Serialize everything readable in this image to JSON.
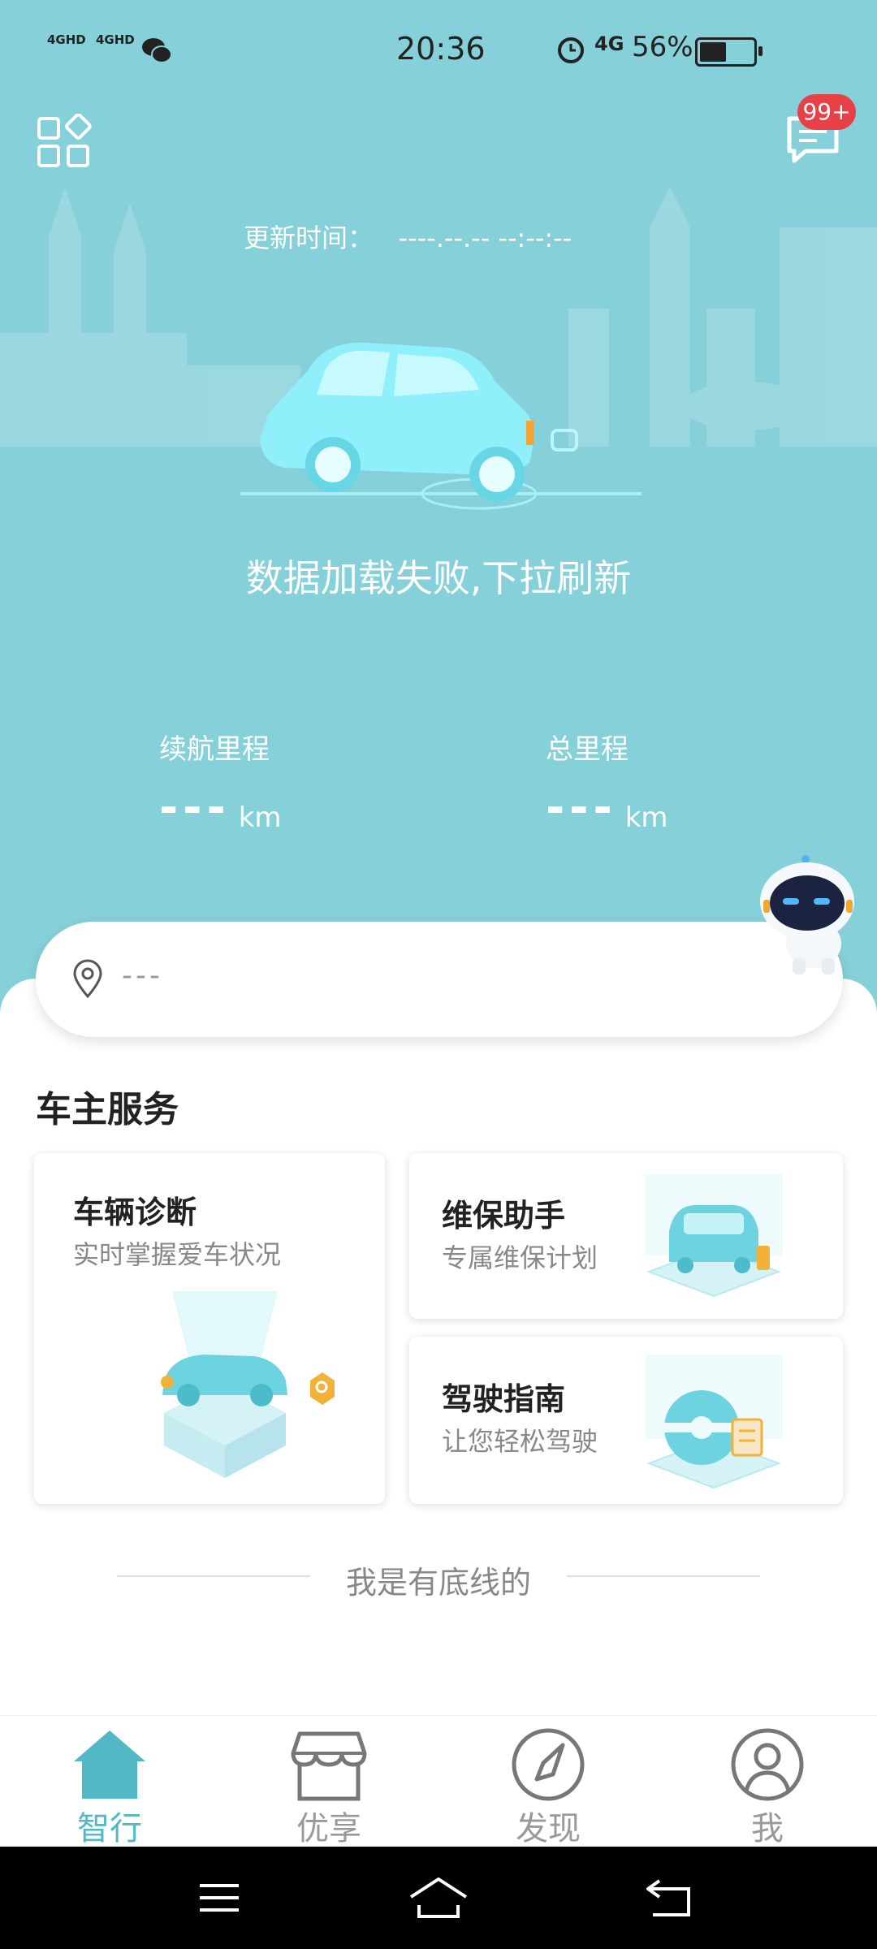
{
  "status_bar": {
    "signal1": "4GHD",
    "signal2": "4GHD",
    "time": "20:36",
    "network": "4G",
    "battery_percent": "56%",
    "battery_level": 0.56
  },
  "header": {
    "message_badge": "99+"
  },
  "update": {
    "label": "更新时间：",
    "value": "----.--.-- --:--:--"
  },
  "load_message": "数据加载失败,下拉刷新",
  "stats": {
    "range": {
      "label": "续航里程",
      "value": "---",
      "unit": "km"
    },
    "total": {
      "label": "总里程",
      "value": "---",
      "unit": "km"
    }
  },
  "location": {
    "text": "---"
  },
  "services": {
    "title": "车主服务",
    "cards": [
      {
        "title": "车辆诊断",
        "subtitle": "实时掌握爱车状况"
      },
      {
        "title": "维保助手",
        "subtitle": "专属维保计划"
      },
      {
        "title": "驾驶指南",
        "subtitle": "让您轻松驾驶"
      }
    ]
  },
  "bottom_line": "我是有底线的",
  "tabs": [
    {
      "label": "智行",
      "icon": "home-icon",
      "active": true
    },
    {
      "label": "优享",
      "icon": "store-icon",
      "active": false
    },
    {
      "label": "发现",
      "icon": "compass-icon",
      "active": false
    },
    {
      "label": "我",
      "icon": "user-icon",
      "active": false
    }
  ],
  "colors": {
    "hero_bg": "#86d0da",
    "accent": "#52b8c6",
    "badge": "#e74047"
  }
}
